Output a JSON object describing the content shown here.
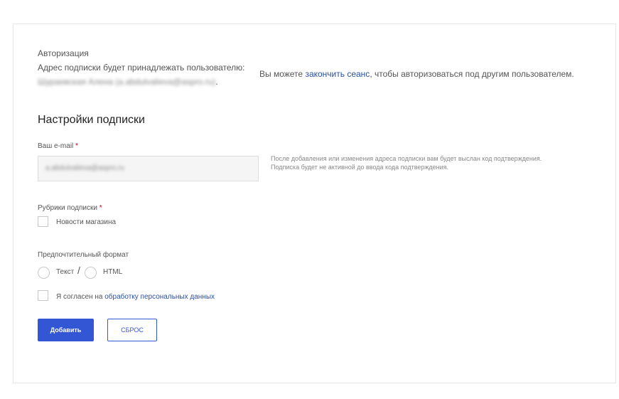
{
  "auth": {
    "heading": "Авторизация",
    "owner_label": "Адрес подписки будет принадлежать пользователю:",
    "owner_value": "Шураевская Алена (a.abdulvalieva@aspro.ru)",
    "owner_suffix": ".",
    "switch_prefix": "Вы можете ",
    "switch_link": "закончить сеанс",
    "switch_suffix": ", чтобы авторизоваться под другим пользователем."
  },
  "settings": {
    "title": "Настройки подписки",
    "email_label": "Ваш e-mail",
    "required_mark": "*",
    "email_value": "a.abdulvalieva@aspro.ru",
    "email_hint_line1": "После добавления или изменения адреса подписки вам будет выслан код подтверждения.",
    "email_hint_line2": "Подписка будет не активной до ввода кода подтверждения.",
    "rubrics_label": "Рубрики подписки",
    "rubrics": [
      {
        "label": "Новости магазина",
        "checked": false
      }
    ],
    "format_label": "Предпочтительный формат",
    "format_options": [
      "Текст",
      "HTML"
    ],
    "format_separator": "/",
    "consent_prefix": "Я согласен на ",
    "consent_link": "обработку персональных данных"
  },
  "buttons": {
    "add": "Добавить",
    "reset": "СБРОС"
  },
  "colors": {
    "accent": "#3356d5",
    "link": "#2a4fa8",
    "required": "#d0021b"
  }
}
